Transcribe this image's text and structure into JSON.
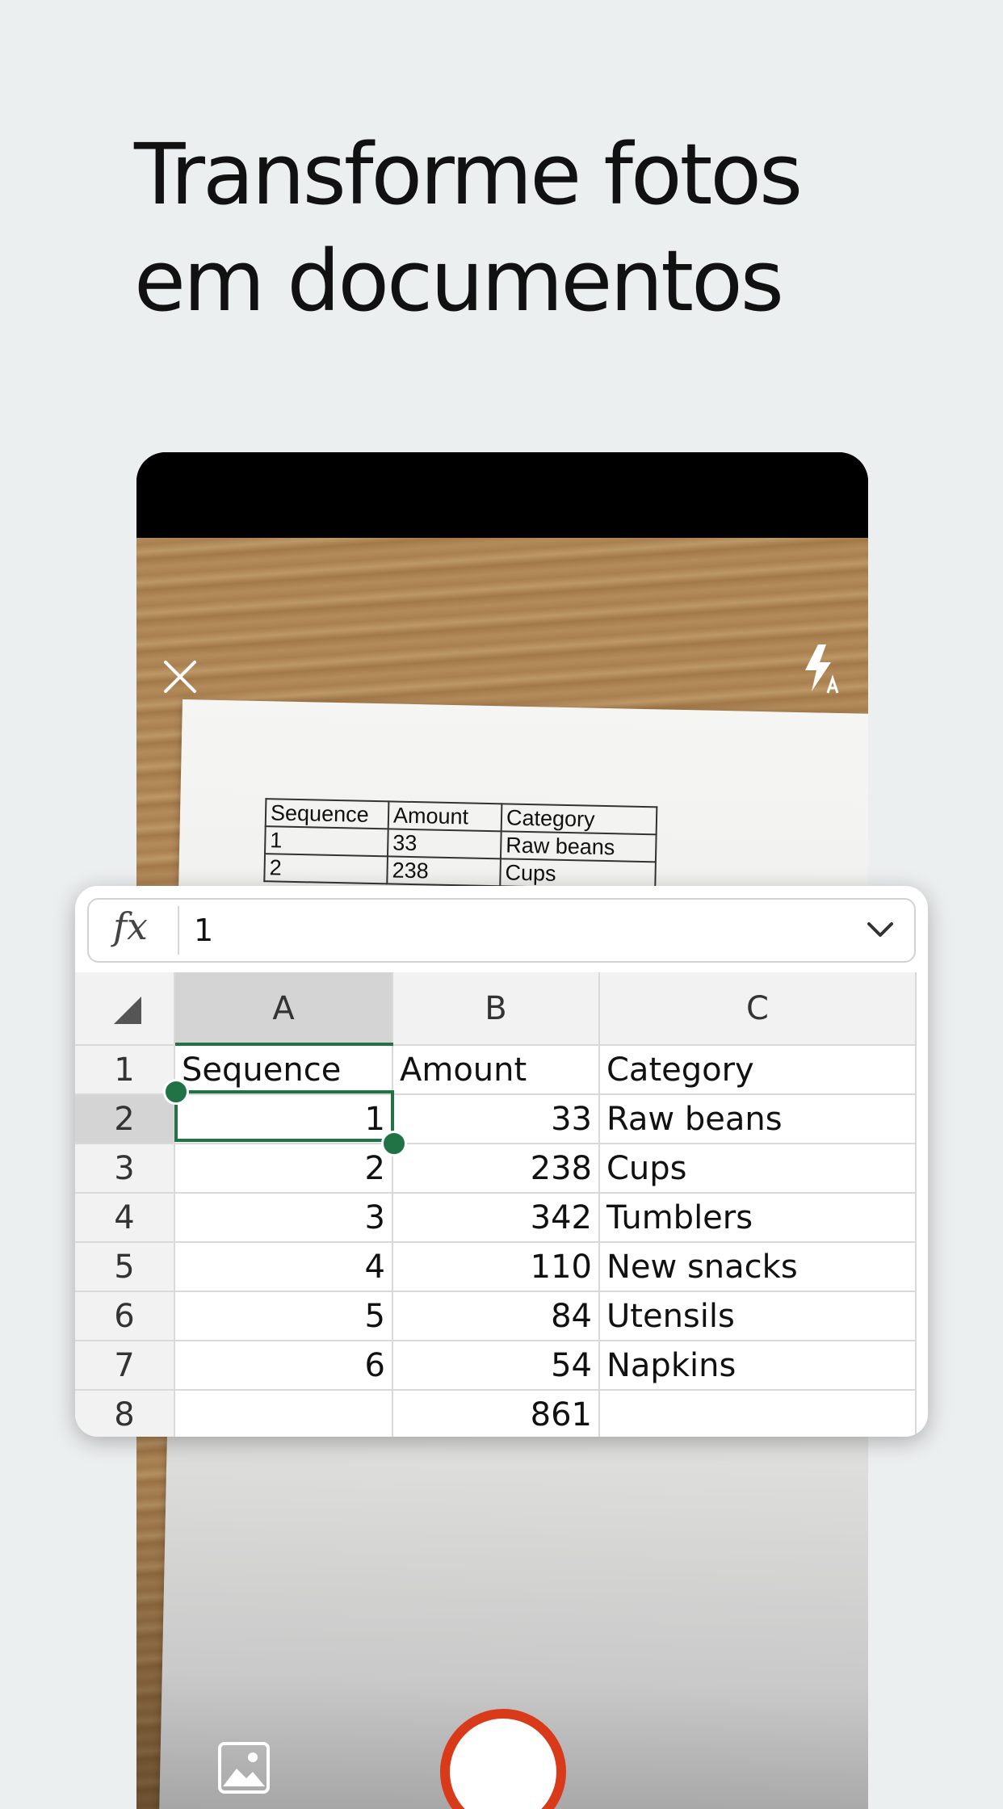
{
  "headline": {
    "line1": "Transforme fotos",
    "line2": "em documentos"
  },
  "camera": {
    "close_icon": "close-icon",
    "flash_icon": "flash-auto-icon",
    "gallery_icon": "gallery-icon",
    "shutter_color": "#d93b1a",
    "paper_table": [
      [
        "Sequence",
        "Amount",
        "Category"
      ],
      [
        "1",
        "33",
        "Raw beans"
      ],
      [
        "2",
        "238",
        "Cups"
      ]
    ]
  },
  "sheet": {
    "formula": {
      "fx_label": "fx",
      "value": "1"
    },
    "accent_color": "#217346",
    "columns": [
      "A",
      "B",
      "C"
    ],
    "selected_column": "A",
    "selected_row": "2",
    "rows": [
      {
        "num": "1",
        "a": "Sequence",
        "b": "Amount",
        "c": "Category"
      },
      {
        "num": "2",
        "a": "1",
        "b": "33",
        "c": "Raw beans"
      },
      {
        "num": "3",
        "a": "2",
        "b": "238",
        "c": "Cups"
      },
      {
        "num": "4",
        "a": "3",
        "b": "342",
        "c": "Tumblers"
      },
      {
        "num": "5",
        "a": "4",
        "b": "110",
        "c": "New snacks"
      },
      {
        "num": "6",
        "a": "5",
        "b": "84",
        "c": "Utensils"
      },
      {
        "num": "7",
        "a": "6",
        "b": "54",
        "c": "Napkins"
      },
      {
        "num": "8",
        "a": "",
        "b": "861",
        "c": ""
      }
    ]
  }
}
